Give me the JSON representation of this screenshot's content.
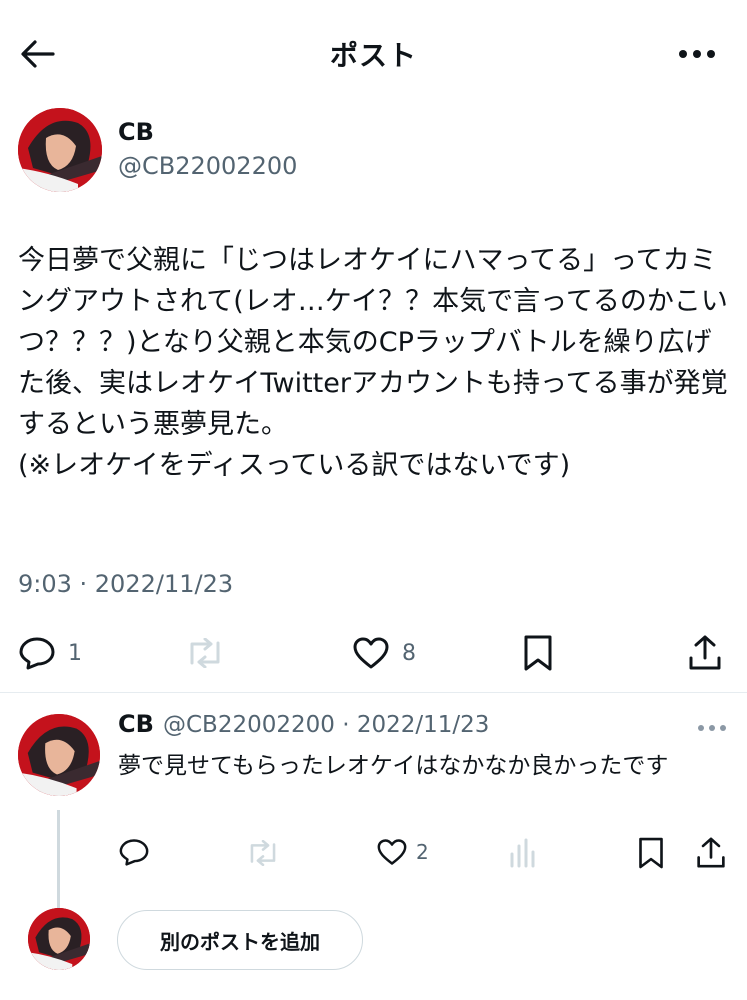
{
  "header": {
    "title": "ポスト"
  },
  "post": {
    "author_name": "CB",
    "author_handle": "@CB22002200",
    "text": "今日夢で父親に「じつはレオケイにハマってる」ってカミングアウトされて(レオ…ケイ？？本気で言ってるのかこいつ？？？)となり父親と本気のCPラップバトルを繰り広げた後、実はレオケイTwitterアカウントも持ってる事が発覚するという悪夢見た。\n(※レオケイをディスっている訳ではないです)",
    "timestamp": "9:03 · 2022/11/23",
    "reply_count": "1",
    "like_count": "8"
  },
  "reply": {
    "author_name": "CB",
    "meta": "@CB22002200 · 2022/11/23",
    "text": "夢で見せてもらったレオケイはなかなか良かったです",
    "like_count": "2"
  },
  "composer": {
    "add_post_label": "別のポストを追加"
  },
  "colors": {
    "text_primary": "#0f1419",
    "text_secondary": "#536471",
    "divider": "#e6ecf0",
    "avatar_bg": "#c4121c"
  }
}
